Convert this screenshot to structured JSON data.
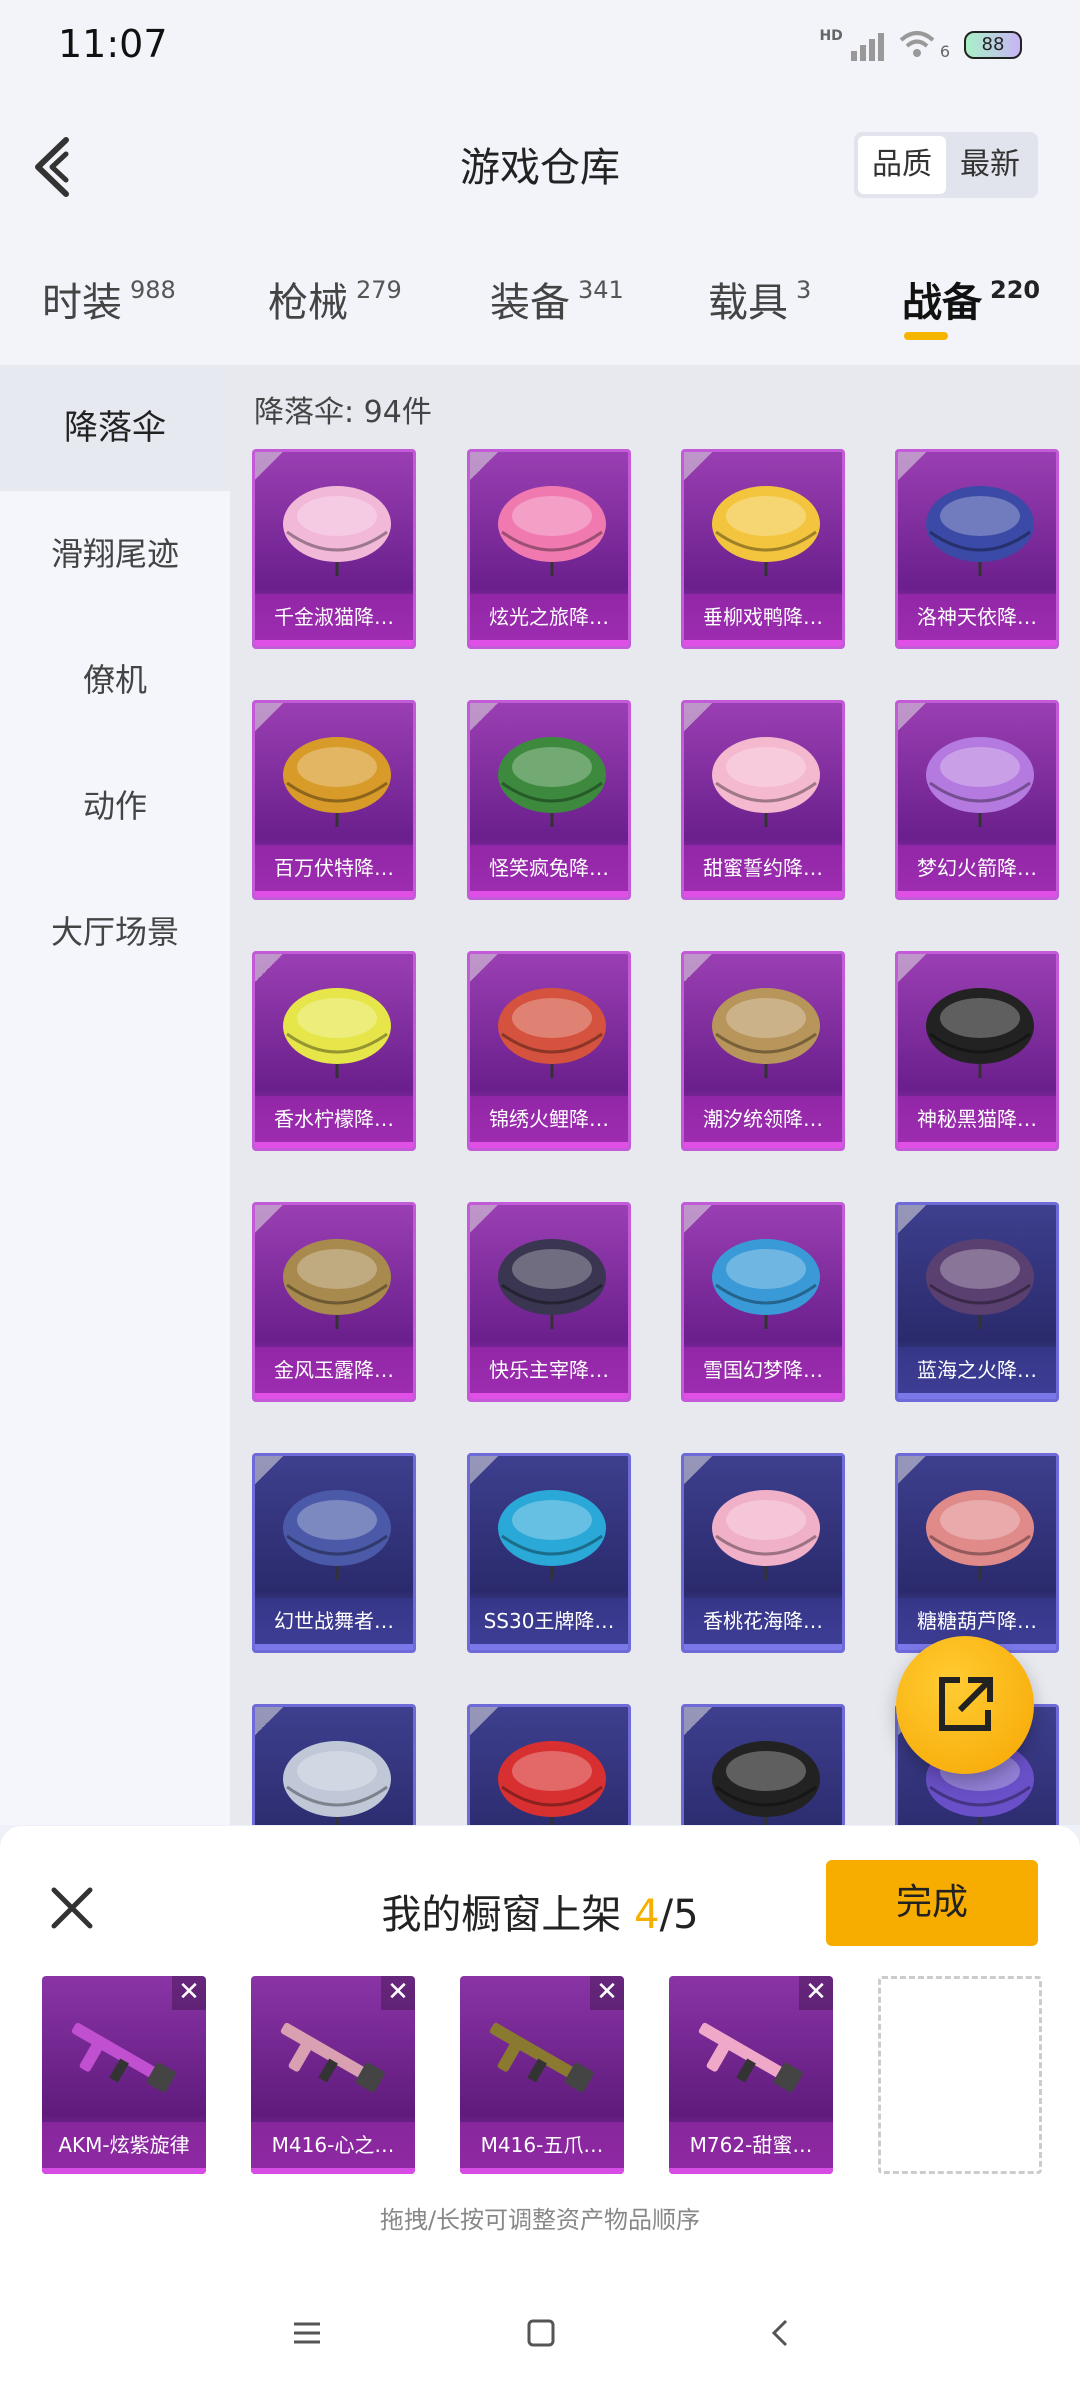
{
  "status": {
    "time": "11:07",
    "hd": "HD",
    "net": "6",
    "battery": "88"
  },
  "header": {
    "title": "游戏仓库",
    "sort": [
      "品质",
      "最新"
    ]
  },
  "tabs": [
    {
      "label": "时装",
      "count": "988"
    },
    {
      "label": "枪械",
      "count": "279"
    },
    {
      "label": "装备",
      "count": "341"
    },
    {
      "label": "载具",
      "count": "3"
    },
    {
      "label": "战备",
      "count": "220"
    }
  ],
  "sidebar": [
    "降落伞",
    "滑翔尾迹",
    "僚机",
    "动作",
    "大厅场景"
  ],
  "section": {
    "label": "降落伞: 94件"
  },
  "items": [
    {
      "name": "千金淑猫降…",
      "rarity": "purple",
      "color": "#f2b8d8"
    },
    {
      "name": "炫光之旅降…",
      "rarity": "purple",
      "color": "#f07ab0"
    },
    {
      "name": "垂柳戏鸭降…",
      "rarity": "purple",
      "color": "#f3c53e"
    },
    {
      "name": "洛神天依降…",
      "rarity": "purple",
      "color": "#3a4aa6"
    },
    {
      "name": "百万伏特降…",
      "rarity": "purple",
      "color": "#d89a28"
    },
    {
      "name": "怪笑疯兔降…",
      "rarity": "purple",
      "color": "#3d8a3f"
    },
    {
      "name": "甜蜜誓约降…",
      "rarity": "purple",
      "color": "#f4b8cf"
    },
    {
      "name": "梦幻火箭降…",
      "rarity": "purple",
      "color": "#b47ae0"
    },
    {
      "name": "香水柠檬降…",
      "rarity": "purple",
      "color": "#e6e64a"
    },
    {
      "name": "锦绣火鲤降…",
      "rarity": "purple",
      "color": "#d4523e"
    },
    {
      "name": "潮汐统领降…",
      "rarity": "purple",
      "color": "#b8955a"
    },
    {
      "name": "神秘黑猫降…",
      "rarity": "purple",
      "color": "#222222"
    },
    {
      "name": "金风玉露降…",
      "rarity": "purple",
      "color": "#a88a4e"
    },
    {
      "name": "快乐主宰降…",
      "rarity": "purple",
      "color": "#3a3550"
    },
    {
      "name": "雪国幻梦降…",
      "rarity": "purple",
      "color": "#3a9ad8"
    },
    {
      "name": "蓝海之火降…",
      "rarity": "blue",
      "color": "#5a4070"
    },
    {
      "name": "幻世战舞者…",
      "rarity": "blue",
      "color": "#4a5aa8"
    },
    {
      "name": "SS30王牌降…",
      "rarity": "blue",
      "color": "#2aa8d8"
    },
    {
      "name": "香桃花海降…",
      "rarity": "blue",
      "color": "#f0b0c8"
    },
    {
      "name": "糖糖葫芦降…",
      "rarity": "blue",
      "color": "#e08a8a"
    },
    {
      "name": "",
      "rarity": "blue",
      "color": "#c0c8d8"
    },
    {
      "name": "",
      "rarity": "blue",
      "color": "#d83030"
    },
    {
      "name": "",
      "rarity": "blue",
      "color": "#222222"
    },
    {
      "name": "",
      "rarity": "blue",
      "color": "#6a50c8"
    }
  ],
  "sheet": {
    "title": "我的橱窗上架",
    "current": "4",
    "total": "/5",
    "done": "完成",
    "hint": "拖拽/长按可调整资产物品顺序",
    "slots": [
      {
        "label": "AKM-炫紫旋律",
        "color": "#c050d0"
      },
      {
        "label": "M416-心之…",
        "color": "#d8a0b0"
      },
      {
        "label": "M416-五爪…",
        "color": "#8a7a30"
      },
      {
        "label": "M762-甜蜜…",
        "color": "#f0a8c8"
      }
    ]
  }
}
